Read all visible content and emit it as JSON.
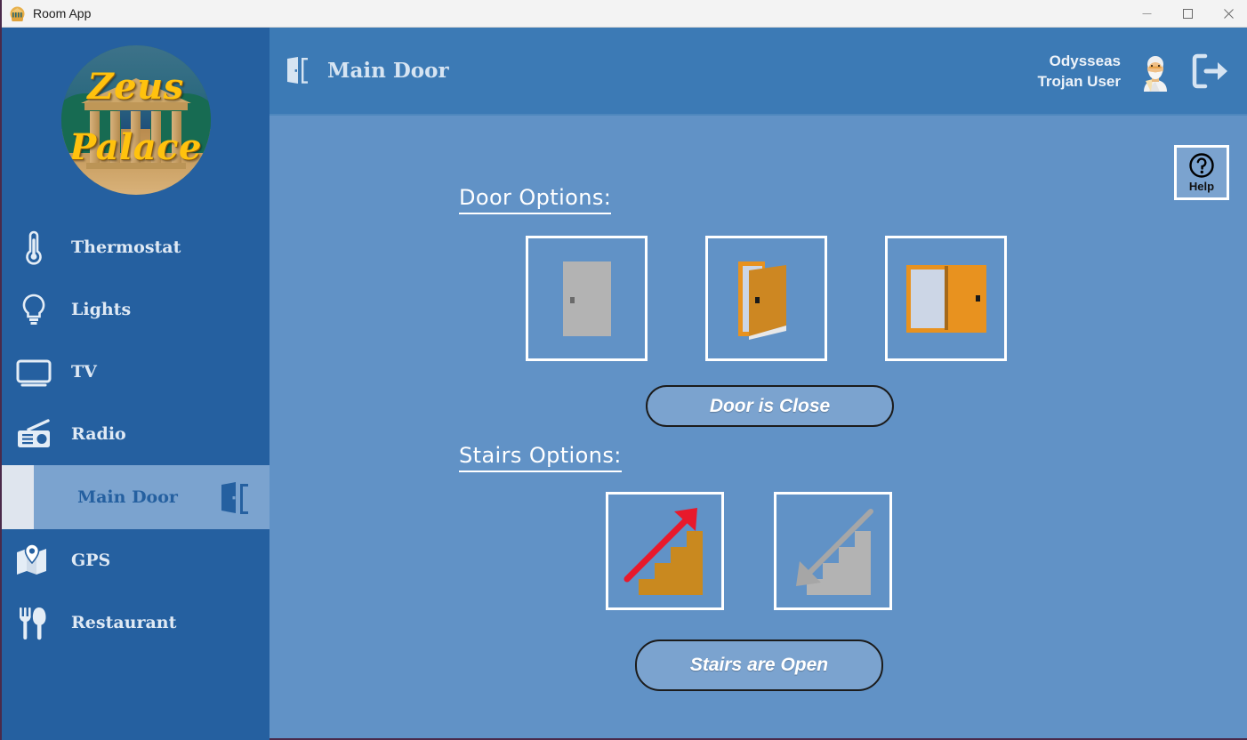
{
  "window": {
    "title": "Room App",
    "app_icon": "zeus-palace-logo-icon",
    "controls": {
      "minimize": "—",
      "maximize": "□",
      "close": "✕"
    }
  },
  "sidebar": {
    "logo": {
      "line1": "Zeus",
      "line2": "Palace",
      "icon": "greek-temple-logo"
    },
    "items": [
      {
        "label": "Thermostat",
        "icon": "thermometer-icon",
        "active": false
      },
      {
        "label": "Lights",
        "icon": "lightbulb-icon",
        "active": false
      },
      {
        "label": "TV",
        "icon": "television-icon",
        "active": false
      },
      {
        "label": "Radio",
        "icon": "radio-icon",
        "active": false
      },
      {
        "label": "Main Door",
        "icon": "door-icon",
        "active": true
      },
      {
        "label": "GPS",
        "icon": "map-pin-icon",
        "active": false
      },
      {
        "label": "Restaurant",
        "icon": "cutlery-icon",
        "active": false
      }
    ]
  },
  "header": {
    "title": "Main Door",
    "title_icon": "door-icon",
    "user": {
      "first_line": "Odysseas",
      "second_line": "Trojan User",
      "avatar_icon": "avatar-old-man-toga"
    },
    "logout_icon": "logout-icon"
  },
  "main": {
    "help": {
      "label": "Help",
      "icon": "question-mark-circle-icon"
    },
    "door_section": {
      "label": "Door Options:",
      "options": [
        {
          "name": "door-closed",
          "icon": "door-closed-icon",
          "color": "#b3b3b3"
        },
        {
          "name": "door-ajar",
          "icon": "door-ajar-icon",
          "color": "#cd8722"
        },
        {
          "name": "door-open",
          "icon": "door-open-icon",
          "color": "#e8921f"
        }
      ],
      "status_label": "Door is Close"
    },
    "stairs_section": {
      "label": "Stairs Options:",
      "options": [
        {
          "name": "stairs-up",
          "icon": "stairs-up-arrow-icon",
          "color": "#c9891f",
          "arrow_color": "#e8192b"
        },
        {
          "name": "stairs-down",
          "icon": "stairs-down-arrow-icon",
          "color": "#b3b3b3",
          "arrow_color": "#a6a6a6"
        }
      ],
      "status_label": "Stairs are Open"
    }
  },
  "colors": {
    "sidebar_bg": "#2560a0",
    "header_bg": "#3c7ab5",
    "content_bg": "#6192c6",
    "active_item_bg": "#7ba3cf",
    "accent_gold": "#ffc20e",
    "door_orange": "#e8921f"
  }
}
